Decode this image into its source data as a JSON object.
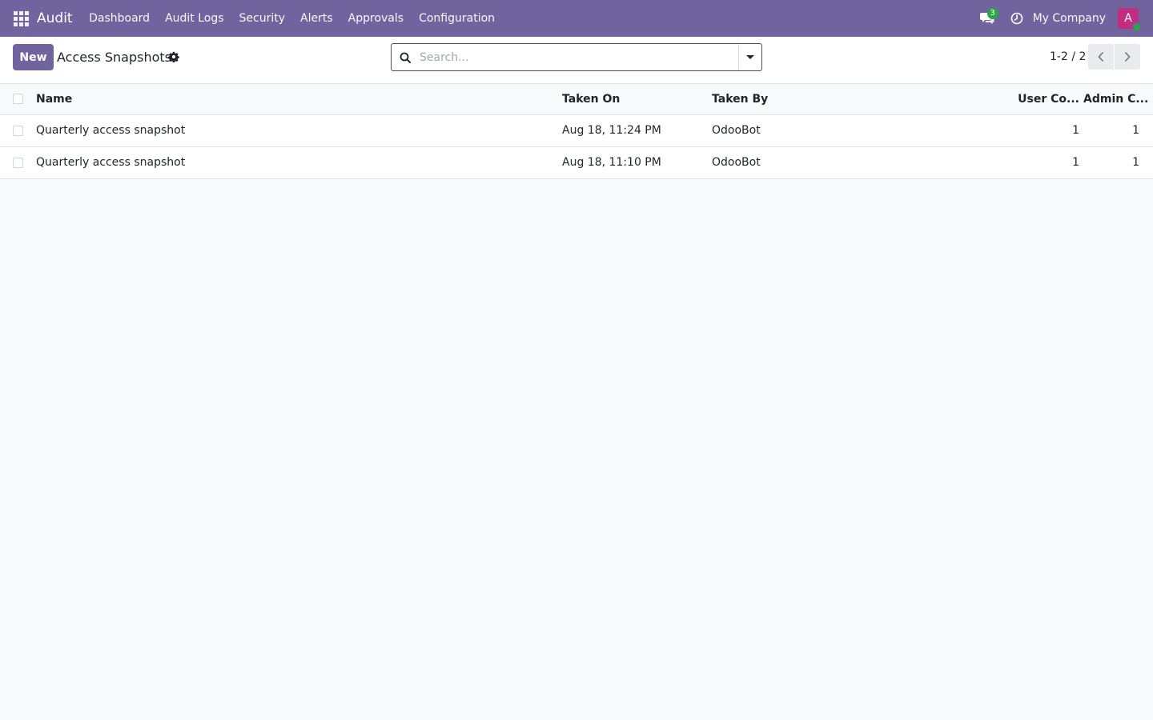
{
  "navbar": {
    "brand": "Audit",
    "menu": [
      {
        "label": "Dashboard"
      },
      {
        "label": "Audit Logs"
      },
      {
        "label": "Security"
      },
      {
        "label": "Alerts"
      },
      {
        "label": "Approvals"
      },
      {
        "label": "Configuration"
      }
    ],
    "messages_count": "3",
    "company": "My Company",
    "avatar_initial": "A",
    "color": "#71639e"
  },
  "control_panel": {
    "new_label": "New",
    "title": "Access Snapshots",
    "search_placeholder": "Search...",
    "pager": "1-2 / 2"
  },
  "table": {
    "columns": {
      "name": "Name",
      "taken_on": "Taken On",
      "taken_by": "Taken By",
      "user_count": "User Co...",
      "admin_count": "Admin C..."
    },
    "rows": [
      {
        "name": "Quarterly access snapshot",
        "taken_on": "Aug 18, 11:24 PM",
        "taken_by": "OdooBot",
        "user_count": "1",
        "admin_count": "1"
      },
      {
        "name": "Quarterly access snapshot",
        "taken_on": "Aug 18, 11:10 PM",
        "taken_by": "OdooBot",
        "user_count": "1",
        "admin_count": "1"
      }
    ]
  }
}
